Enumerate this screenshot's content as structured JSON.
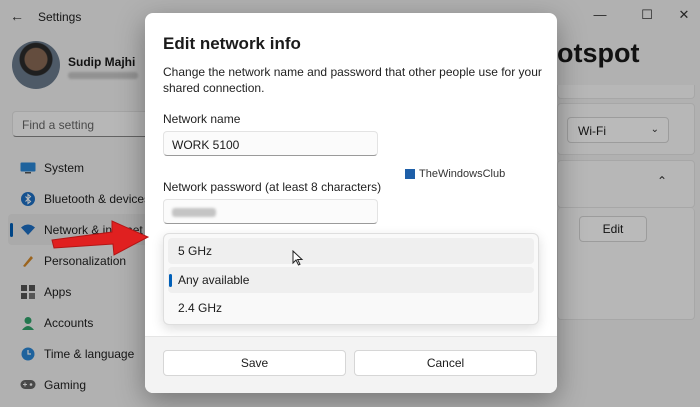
{
  "window": {
    "title": "Settings",
    "back_icon": "←",
    "minimize_icon": "—",
    "maximize_icon": "☐",
    "close_icon": "✕"
  },
  "profile": {
    "name": "Sudip Majhi"
  },
  "search": {
    "placeholder": "Find a setting"
  },
  "sidebar": {
    "items": [
      {
        "label": "System",
        "icon": "monitor-icon"
      },
      {
        "label": "Bluetooth & devices",
        "icon": "bluetooth-icon"
      },
      {
        "label": "Network & internet",
        "icon": "wifi-icon"
      },
      {
        "label": "Personalization",
        "icon": "brush-icon"
      },
      {
        "label": "Apps",
        "icon": "apps-icon"
      },
      {
        "label": "Accounts",
        "icon": "person-icon"
      },
      {
        "label": "Time & language",
        "icon": "globe-clock-icon"
      },
      {
        "label": "Gaming",
        "icon": "gamepad-icon"
      }
    ]
  },
  "right_panel": {
    "title_fragment": "otspot",
    "band_select_value": "Wi-Fi",
    "edit_button": "Edit"
  },
  "dialog": {
    "title": "Edit network info",
    "description": "Change the network name and password that other people use for your shared connection.",
    "network_name_label": "Network name",
    "network_name_value": "WORK 5100",
    "password_label": "Network password (at least 8 characters)",
    "band_options": [
      {
        "label": "5 GHz",
        "state": "hover"
      },
      {
        "label": "Any available",
        "state": "selected"
      },
      {
        "label": "2.4 GHz",
        "state": "normal"
      }
    ],
    "save_label": "Save",
    "cancel_label": "Cancel"
  },
  "watermark": {
    "text": "TheWindowsClub"
  },
  "colors": {
    "accent": "#005fb8",
    "arrow": "#e02020",
    "overlay": "rgba(0,0,0,0.27)"
  }
}
